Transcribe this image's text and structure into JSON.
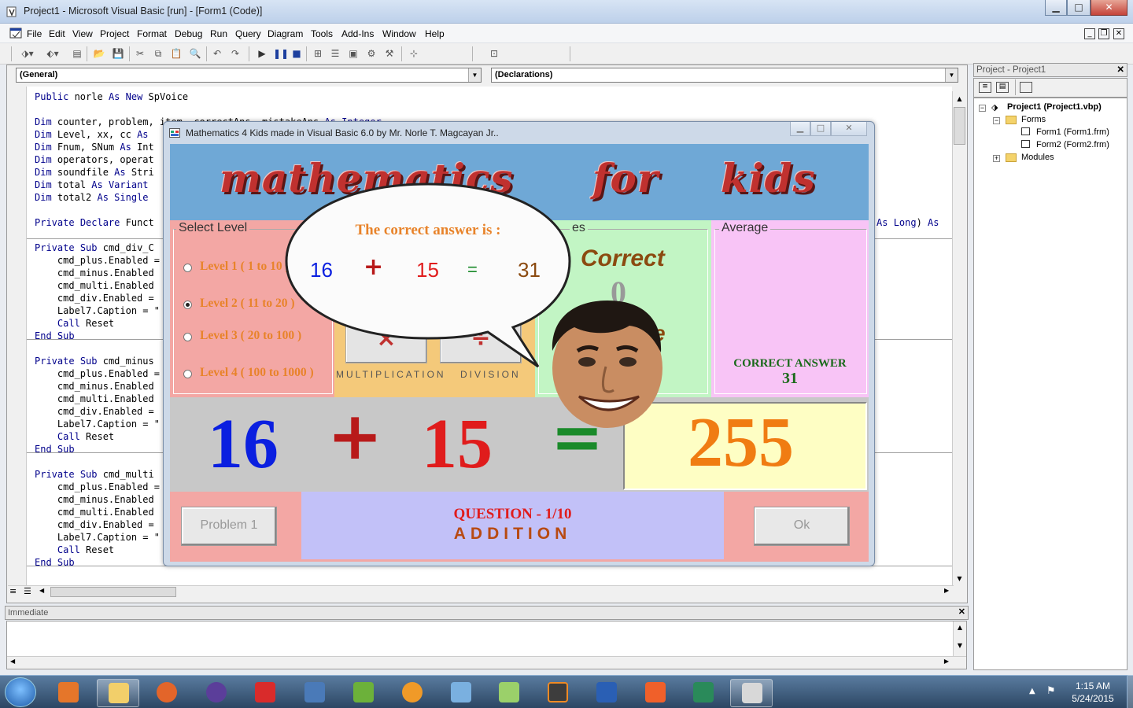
{
  "window": {
    "title": "Project1 - Microsoft Visual Basic [run] - [Form1 (Code)]",
    "min_label": "▁",
    "max_label": "□",
    "close_label": "✕"
  },
  "menu": [
    "File",
    "Edit",
    "View",
    "Project",
    "Format",
    "Debug",
    "Run",
    "Query",
    "Diagram",
    "Tools",
    "Add-Ins",
    "Window",
    "Help"
  ],
  "code": {
    "object_combo": "(General)",
    "proc_combo": "(Declarations)",
    "lines": [
      "Public norle As New SpVoice",
      "",
      "Dim counter, problem, item, correctAns, mistakeAns As Integer",
      "Dim Level, xx, cc As",
      "Dim Fnum, SNum As Int",
      "Dim operators, operat",
      "Dim soundfile As Stri",
      "Dim total As Variant",
      "Dim total2 As Single",
      "",
      "Private Declare Funct",
      "",
      "Private Sub cmd_div_C",
      "    cmd_plus.Enabled =",
      "    cmd_minus.Enabled",
      "    cmd_multi.Enabled",
      "    cmd_div.Enabled =",
      "    Label7.Caption = \"",
      "    Call Reset",
      "End Sub",
      "",
      "Private Sub cmd_minus",
      "    cmd_plus.Enabled =",
      "    cmd_minus.Enabled",
      "    cmd_multi.Enabled",
      "    cmd_div.Enabled =",
      "    Label7.Caption = \"",
      "    Call Reset",
      "End Sub",
      "",
      "Private Sub cmd_multi",
      "    cmd_plus.Enabled =",
      "    cmd_minus.Enabled",
      "    cmd_multi.Enabled",
      "    cmd_div.Enabled =",
      "    Label7.Caption = \"",
      "    Call Reset",
      "End Sub"
    ],
    "declare_tail": "As Long) As"
  },
  "immediate": {
    "title": "Immediate"
  },
  "project": {
    "title": "Project - Project1",
    "root": "Project1 (Project1.vbp)",
    "forms_folder": "Forms",
    "form1": "Form1 (Form1.frm)",
    "form2": "Form2 (Form2.frm)",
    "modules_folder": "Modules"
  },
  "form": {
    "title": "Mathematics 4 Kids made in Visual Basic 6.0 by Mr. Norle T. Magcayan Jr..",
    "banner_words": [
      "mathematics",
      "for",
      "kids"
    ],
    "select_level": "Select Level",
    "levels": [
      "Level 1  ( 1 to 10 )",
      "Level 2  ( 11 to 20 )",
      "Level 3  ( 20 to 100 )",
      "Level 4  ( 100 to 1000 )"
    ],
    "selected_level_index": 1,
    "ops": {
      "multiplication": "MULTIPLICATION",
      "division": "DIVISION",
      "mul_symbol": "×",
      "div_symbol": "÷"
    },
    "scores_label": "es",
    "correct_label": "Correct",
    "correct_value": "0",
    "mistake_tail": "e",
    "average_label": "Average",
    "correct_answer_label": "CORRECT ANSWER",
    "correct_answer_value": "31",
    "problem": {
      "first": "16",
      "op": "+",
      "second": "15",
      "eq": "=",
      "answer": "255"
    },
    "problem_button": "Problem  1",
    "question": "QUESTION  -  1/10",
    "operation": "ADDITION",
    "ok_button": "Ok",
    "bubble": {
      "title": "The correct answer is  :",
      "a": "16",
      "op": "+",
      "b": "15",
      "eq": "=",
      "result": "31"
    }
  },
  "taskbar": {
    "time": "1:15 AM",
    "date": "5/24/2015"
  },
  "colors": {
    "accent_orange": "#f07c12",
    "accent_red": "#e01c1c",
    "accent_blue": "#0a1fe0",
    "accent_green": "#1a8a2a",
    "level_text": "#e8832a"
  }
}
